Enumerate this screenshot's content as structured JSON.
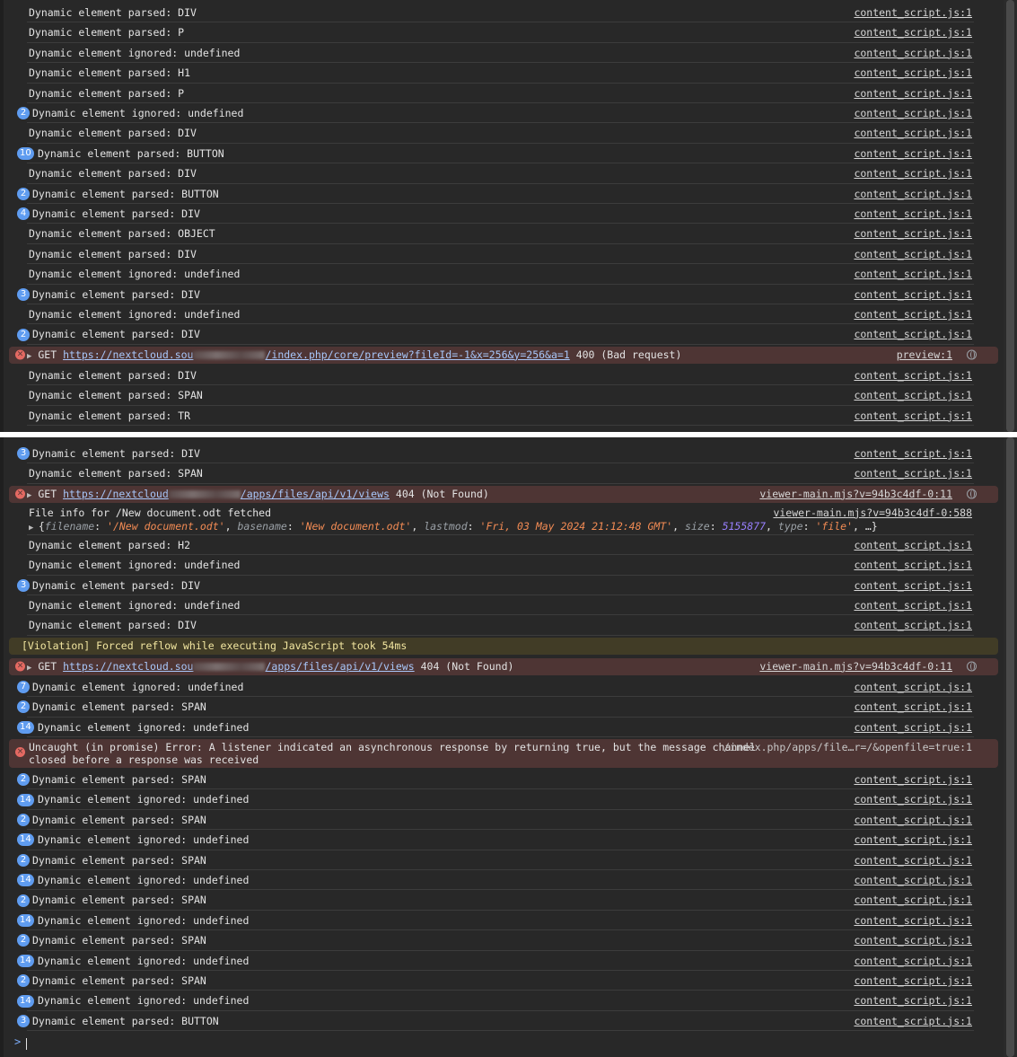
{
  "top_rows": [
    {
      "type": "log",
      "badge": "",
      "text": "Dynamic element parsed: DIV",
      "src": "content_script.js:1"
    },
    {
      "type": "log",
      "badge": "",
      "text": "Dynamic element parsed: P",
      "src": "content_script.js:1"
    },
    {
      "type": "log",
      "badge": "",
      "text": "Dynamic element ignored: undefined",
      "src": "content_script.js:1"
    },
    {
      "type": "log",
      "badge": "",
      "text": "Dynamic element parsed: H1",
      "src": "content_script.js:1"
    },
    {
      "type": "log",
      "badge": "",
      "text": "Dynamic element parsed: P",
      "src": "content_script.js:1"
    },
    {
      "type": "log",
      "badge": "2",
      "text": "Dynamic element ignored: undefined",
      "src": "content_script.js:1"
    },
    {
      "type": "log",
      "badge": "",
      "text": "Dynamic element parsed: DIV",
      "src": "content_script.js:1"
    },
    {
      "type": "log",
      "badge": "10",
      "text": "Dynamic element parsed: BUTTON",
      "src": "content_script.js:1"
    },
    {
      "type": "log",
      "badge": "",
      "text": "Dynamic element parsed: DIV",
      "src": "content_script.js:1"
    },
    {
      "type": "log",
      "badge": "2",
      "text": "Dynamic element parsed: BUTTON",
      "src": "content_script.js:1"
    },
    {
      "type": "log",
      "badge": "4",
      "text": "Dynamic element parsed: DIV",
      "src": "content_script.js:1"
    },
    {
      "type": "log",
      "badge": "",
      "text": "Dynamic element parsed: OBJECT",
      "src": "content_script.js:1"
    },
    {
      "type": "log",
      "badge": "",
      "text": "Dynamic element parsed: DIV",
      "src": "content_script.js:1"
    },
    {
      "type": "log",
      "badge": "",
      "text": "Dynamic element ignored: undefined",
      "src": "content_script.js:1"
    },
    {
      "type": "log",
      "badge": "3",
      "text": "Dynamic element parsed: DIV",
      "src": "content_script.js:1"
    },
    {
      "type": "log",
      "badge": "",
      "text": "Dynamic element ignored: undefined",
      "src": "content_script.js:1"
    },
    {
      "type": "log",
      "badge": "2",
      "text": "Dynamic element parsed: DIV",
      "src": "content_script.js:1"
    },
    {
      "type": "net-error",
      "method": "GET",
      "url_start": "https://nextcloud.sou",
      "url_end": "/index.php/core/preview?fileId=-1&x=256&y=256&a=1",
      "status": "400 (Bad request)",
      "src": "preview:1"
    },
    {
      "type": "log",
      "badge": "",
      "text": "Dynamic element parsed: DIV",
      "src": "content_script.js:1"
    },
    {
      "type": "log",
      "badge": "",
      "text": "Dynamic element parsed: SPAN",
      "src": "content_script.js:1"
    },
    {
      "type": "log",
      "badge": "",
      "text": "Dynamic element parsed: TR",
      "src": "content_script.js:1"
    }
  ],
  "bottom_rows": [
    {
      "type": "log",
      "badge": "3",
      "text": "Dynamic element parsed: DIV",
      "src": "content_script.js:1"
    },
    {
      "type": "log",
      "badge": "",
      "text": "Dynamic element parsed: SPAN",
      "src": "content_script.js:1"
    },
    {
      "type": "net-error",
      "method": "GET",
      "url_start": "https://nextcloud",
      "url_end": "/apps/files/api/v1/views",
      "status": "404 (Not Found)",
      "src": "viewer-main.mjs?v=94b3c4df-0:11"
    },
    {
      "type": "fileinfo",
      "text": "File info for /New document.odt fetched",
      "src": "viewer-main.mjs?v=94b3c4df-0:588",
      "obj": {
        "k1": "filename",
        "v1": "'/New document.odt'",
        "k2": "basename",
        "v2": "'New document.odt'",
        "k3": "lastmod",
        "v3": "'Fri, 03 May 2024 21:12:48 GMT'",
        "k4": "size",
        "v4": "5155877",
        "k5": "type",
        "v5": "'file'",
        "tail": ", …}"
      }
    },
    {
      "type": "log",
      "badge": "",
      "text": "Dynamic element parsed: H2",
      "src": "content_script.js:1"
    },
    {
      "type": "log",
      "badge": "",
      "text": "Dynamic element ignored: undefined",
      "src": "content_script.js:1"
    },
    {
      "type": "log",
      "badge": "3",
      "text": "Dynamic element parsed: DIV",
      "src": "content_script.js:1"
    },
    {
      "type": "log",
      "badge": "",
      "text": "Dynamic element ignored: undefined",
      "src": "content_script.js:1"
    },
    {
      "type": "log",
      "badge": "",
      "text": "Dynamic element parsed: DIV",
      "src": "content_script.js:1"
    },
    {
      "type": "warn",
      "text": "[Violation] Forced reflow while executing JavaScript took 54ms"
    },
    {
      "type": "net-error",
      "method": "GET",
      "url_start": "https://nextcloud.sou",
      "url_end": "/apps/files/api/v1/views",
      "status": "404 (Not Found)",
      "src": "viewer-main.mjs?v=94b3c4df-0:11"
    },
    {
      "type": "log",
      "badge": "7",
      "text": "Dynamic element ignored: undefined",
      "src": "content_script.js:1"
    },
    {
      "type": "log",
      "badge": "2",
      "text": "Dynamic element parsed: SPAN",
      "src": "content_script.js:1"
    },
    {
      "type": "log",
      "badge": "14",
      "text": "Dynamic element ignored: undefined",
      "src": "content_script.js:1"
    },
    {
      "type": "uncaught",
      "line1": "Uncaught (in promise) Error: A listener indicated an asynchronous response by returning true, but the message channel",
      "line2": "closed before a response was received",
      "src": "/index.php/apps/file…r=/&openfile=true:1"
    },
    {
      "type": "log",
      "badge": "2",
      "text": "Dynamic element parsed: SPAN",
      "src": "content_script.js:1"
    },
    {
      "type": "log",
      "badge": "14",
      "text": "Dynamic element ignored: undefined",
      "src": "content_script.js:1"
    },
    {
      "type": "log",
      "badge": "2",
      "text": "Dynamic element parsed: SPAN",
      "src": "content_script.js:1"
    },
    {
      "type": "log",
      "badge": "14",
      "text": "Dynamic element ignored: undefined",
      "src": "content_script.js:1"
    },
    {
      "type": "log",
      "badge": "2",
      "text": "Dynamic element parsed: SPAN",
      "src": "content_script.js:1"
    },
    {
      "type": "log",
      "badge": "14",
      "text": "Dynamic element ignored: undefined",
      "src": "content_script.js:1"
    },
    {
      "type": "log",
      "badge": "2",
      "text": "Dynamic element parsed: SPAN",
      "src": "content_script.js:1"
    },
    {
      "type": "log",
      "badge": "14",
      "text": "Dynamic element ignored: undefined",
      "src": "content_script.js:1"
    },
    {
      "type": "log",
      "badge": "2",
      "text": "Dynamic element parsed: SPAN",
      "src": "content_script.js:1"
    },
    {
      "type": "log",
      "badge": "14",
      "text": "Dynamic element ignored: undefined",
      "src": "content_script.js:1"
    },
    {
      "type": "log",
      "badge": "2",
      "text": "Dynamic element parsed: SPAN",
      "src": "content_script.js:1"
    },
    {
      "type": "log",
      "badge": "14",
      "text": "Dynamic element ignored: undefined",
      "src": "content_script.js:1"
    },
    {
      "type": "log",
      "badge": "3",
      "text": "Dynamic element parsed: BUTTON",
      "src": "content_script.js:1"
    }
  ],
  "prompt": {
    "symbol": ">"
  }
}
